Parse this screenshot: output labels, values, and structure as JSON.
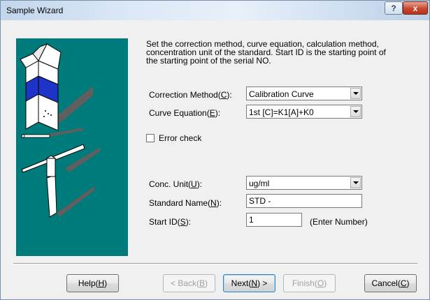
{
  "window": {
    "title": "Sample Wizard",
    "help_glyph": "?",
    "close_glyph": "x"
  },
  "description": "Set the correction method, curve equation, calculation method, concentration unit of the standard. Start ID is the starting point of the starting point of the serial NO.",
  "form": {
    "correction_method": {
      "label_pre": "Correction Method(",
      "label_key": "C",
      "label_post": "):",
      "value": "Calibration Curve"
    },
    "curve_equation": {
      "label_pre": "Curve Equation(",
      "label_key": "E",
      "label_post": "):",
      "value": "1st [C]=K1[A]+K0"
    },
    "error_check": {
      "label": "Error check",
      "checked": false
    },
    "conc_unit": {
      "label_pre": "Conc. Unit(",
      "label_key": "U",
      "label_post": "):",
      "value": "ug/ml"
    },
    "standard_name": {
      "label_pre": "Standard  Name(",
      "label_key": "N",
      "label_post": "):",
      "value": "STD -"
    },
    "start_id": {
      "label_pre": "Start ID(",
      "label_key": "S",
      "label_post": "):",
      "value": "1",
      "hint": "(Enter Number)"
    }
  },
  "buttons": {
    "help": {
      "pre": "Help(",
      "key": "H",
      "post": ")"
    },
    "back": {
      "pre": "< Back(",
      "key": "B",
      "post": ")"
    },
    "next": {
      "pre": "Next(",
      "key": "N",
      "post": ") >"
    },
    "finish": {
      "pre": "Finish(",
      "key": "O",
      "post": ")"
    },
    "cancel": {
      "pre": "Cancel(",
      "key": "C",
      "post": ")"
    }
  },
  "colors": {
    "art_background": "#007b7b",
    "box_stripe": "#1e33c8"
  },
  "icons": {
    "help": "question-mark",
    "close": "x-mark",
    "dropdown": "triangle-down"
  }
}
